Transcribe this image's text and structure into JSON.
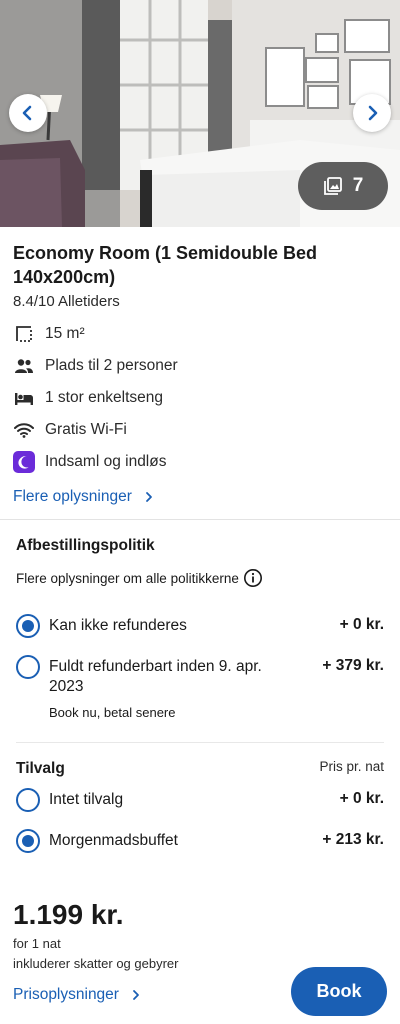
{
  "gallery": {
    "photo_count": "7",
    "icons": {
      "prev": "chevron-left-icon",
      "next": "chevron-right-icon",
      "gallery": "image-gallery-icon"
    }
  },
  "room": {
    "title": "Economy Room (1 Semidouble Bed 140x200cm)",
    "rating": "8.4/10 Alletiders",
    "amenities": [
      {
        "icon": "room-size-icon",
        "label": "15 m²"
      },
      {
        "icon": "people-icon",
        "label": "Plads til 2 personer"
      },
      {
        "icon": "bed-icon",
        "label": "1 stor enkeltseng"
      },
      {
        "icon": "wifi-icon",
        "label": "Gratis Wi-Fi"
      },
      {
        "icon": "rewards-moon-icon",
        "label": "Indsaml og indløs"
      }
    ],
    "more_info_link": "Flere oplysninger"
  },
  "cancellation": {
    "title": "Afbestillingspolitik",
    "more_link": "Flere oplysninger om alle politikkerne",
    "options": [
      {
        "label": "Kan ikke refunderes",
        "price": "+ 0 kr.",
        "sub": "",
        "selected": true
      },
      {
        "label": "Fuldt refunderbart inden 9. apr. 2023",
        "price": "+ 379 kr.",
        "sub": "Book nu, betal senere",
        "selected": false
      }
    ]
  },
  "extras": {
    "title": "Tilvalg",
    "price_note": "Pris pr. nat",
    "options": [
      {
        "label": "Intet tilvalg",
        "price": "+ 0 kr.",
        "selected": false
      },
      {
        "label": "Morgenmadsbuffet",
        "price": "+ 213 kr.",
        "selected": true
      }
    ]
  },
  "summary": {
    "total": "1.199 kr.",
    "per_night": "for 1 nat",
    "taxes_note": "inkluderer skatter og gebyrer",
    "price_details_link": "Prisoplysninger",
    "book_label": "Book"
  },
  "colors": {
    "accent": "#1a5fb4",
    "rewards": "#6b2bd9"
  }
}
